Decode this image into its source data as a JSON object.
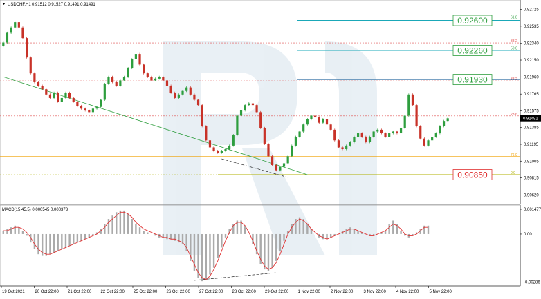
{
  "chart_data": [
    {
      "type": "line",
      "header_symbol": "USDCHF,H1",
      "header_values": "0.91512 0.91527 0.91491 0.91491",
      "y_ticks": [
        "0.92725",
        "0.92535",
        "0.92340",
        "0.92150",
        "0.91960",
        "0.91765",
        "0.91575",
        "0.91385",
        "0.91195",
        "0.91005",
        "0.90815",
        "0.90620"
      ],
      "y_ticks_num": [
        0.92725,
        0.92535,
        0.9234,
        0.9215,
        0.9196,
        0.91765,
        0.91575,
        0.91385,
        0.91195,
        0.91005,
        0.90815,
        0.9062
      ],
      "ylim": [
        0.90545,
        0.928
      ],
      "x_ticks": [
        "19 Oct 2021",
        "20 Oct 22:00",
        "21 Oct 22:00",
        "22 Oct 22:00",
        "25 Oct 22:00",
        "26 Oct 22:00",
        "27 Oct 22:00",
        "28 Oct 22:00",
        "29 Oct 22:00",
        "1 Nov 22:00",
        "2 Nov 22:00",
        "3 Nov 22:00",
        "4 Nov 22:00",
        "5 Nov 22:00"
      ],
      "current_price": "0.91491",
      "current_price_num": 0.91491,
      "fib_levels": [
        {
          "label": "61.8",
          "value": 0.92615,
          "color": "#2e9e3e"
        },
        {
          "label": "38.2",
          "value": 0.92345,
          "color": "#e05050"
        },
        {
          "label": "50.0",
          "value": 0.92265,
          "color": "#2e9e3e"
        },
        {
          "label": "38.2",
          "value": 0.91915,
          "color": "#e05050"
        },
        {
          "label": "23.6",
          "value": 0.91517,
          "color": "#e05050"
        },
        {
          "label": "76.0",
          "value": 0.91055,
          "color": "#f0a000"
        },
        {
          "label": "0.0",
          "value": 0.9085,
          "color": "#b0b000"
        }
      ],
      "targets": [
        {
          "text": "0.92600",
          "value": 0.926,
          "color": "#2e9e3e",
          "line": "#1aa8b8"
        },
        {
          "text": "0.92260",
          "value": 0.9226,
          "color": "#2e9e3e",
          "line": "#1aa8b8"
        },
        {
          "text": "0.91930",
          "value": 0.9193,
          "color": "#2e9e3e",
          "line": "#2a6aa0"
        },
        {
          "text": "0.90850",
          "value": 0.9085,
          "color": "#e03030",
          "line": "#b0b000"
        }
      ],
      "close_series": [
        0.9235,
        0.9246,
        0.9252,
        0.9258,
        0.9252,
        0.924,
        0.9218,
        0.92,
        0.919,
        0.9186,
        0.9182,
        0.9176,
        0.9172,
        0.9178,
        0.9168,
        0.9172,
        0.9178,
        0.9172,
        0.9168,
        0.9163,
        0.916,
        0.9158,
        0.9156,
        0.916,
        0.9162,
        0.917,
        0.9188,
        0.9196,
        0.919,
        0.9186,
        0.9192,
        0.9196,
        0.9206,
        0.9216,
        0.9222,
        0.921,
        0.92,
        0.9196,
        0.9192,
        0.9194,
        0.9196,
        0.9192,
        0.9186,
        0.9178,
        0.9172,
        0.9176,
        0.918,
        0.9184,
        0.9176,
        0.917,
        0.9164,
        0.914,
        0.9124,
        0.9116,
        0.9112,
        0.911,
        0.9112,
        0.9114,
        0.9118,
        0.913,
        0.9152,
        0.9158,
        0.9164,
        0.9166,
        0.9164,
        0.9156,
        0.9138,
        0.912,
        0.9106,
        0.9096,
        0.909,
        0.9094,
        0.9098,
        0.9106,
        0.9118,
        0.9128,
        0.9134,
        0.9142,
        0.9148,
        0.9152,
        0.915,
        0.9144,
        0.9148,
        0.9142,
        0.9136,
        0.9124,
        0.9116,
        0.9114,
        0.9118,
        0.9122,
        0.9128,
        0.9132,
        0.9128,
        0.9122,
        0.9128,
        0.9134,
        0.9136,
        0.9132,
        0.9128,
        0.9132,
        0.9134,
        0.9132,
        0.9138,
        0.9152,
        0.9176,
        0.9164,
        0.914,
        0.9126,
        0.9118,
        0.9124,
        0.9128,
        0.9132,
        0.914,
        0.9146,
        0.9149
      ],
      "macd": {
        "label": "MACD(15,45,5) 0.000545 0.000373",
        "y_ticks": [
          "0.001477",
          "0.00",
          "-0.00286"
        ],
        "y_ticks_num": [
          0.001477,
          0.0,
          -0.00286
        ],
        "ylim": [
          -0.003,
          0.0016
        ],
        "hist": [
          0.0002,
          0.0003,
          0.0004,
          0.0005,
          0.0004,
          0.0002,
          -0.0001,
          -0.0005,
          -0.0009,
          -0.0012,
          -0.0013,
          -0.0013,
          -0.0012,
          -0.0011,
          -0.001,
          -0.0009,
          -0.0008,
          -0.0007,
          -0.0006,
          -0.0005,
          -0.0004,
          -0.0003,
          -0.0002,
          -0.0001,
          0.0001,
          0.0003,
          0.0006,
          0.0009,
          0.0011,
          0.0013,
          0.0014,
          0.0014,
          0.0012,
          0.0009,
          0.0006,
          0.0004,
          0.0002,
          0.0001,
          -0.0,
          -0.0001,
          -0.0002,
          -0.0002,
          -0.0003,
          -0.0003,
          -0.0004,
          -0.0005,
          -0.0006,
          -0.001,
          -0.0016,
          -0.0022,
          -0.0026,
          -0.0028,
          -0.0027,
          -0.0024,
          -0.002,
          -0.0014,
          -0.0008,
          -0.0002,
          0.0003,
          0.0006,
          0.0008,
          0.0008,
          0.0005,
          0.0,
          -0.0006,
          -0.0012,
          -0.0018,
          -0.0021,
          -0.0022,
          -0.002,
          -0.0016,
          -0.001,
          -0.0004,
          0.0002,
          0.0006,
          0.0009,
          0.001,
          0.0009,
          0.0006,
          0.0003,
          0.0,
          -0.0002,
          -0.0003,
          -0.0003,
          -0.0002,
          -0.0001,
          0.0,
          0.0002,
          0.0003,
          0.0004,
          0.0003,
          0.0002,
          0.0001,
          0.0,
          -0.0001,
          -0.0001,
          0.0,
          0.0001,
          0.0002,
          0.0006,
          0.0008,
          0.0006,
          0.0002,
          -0.0001,
          -0.0002,
          -0.0001,
          0.0001,
          0.0003,
          0.0005,
          0.0005
        ],
        "signal": [
          0.0002,
          0.0002,
          0.0003,
          0.0004,
          0.0004,
          0.0003,
          0.0001,
          -0.0002,
          -0.0006,
          -0.0009,
          -0.0011,
          -0.0012,
          -0.0012,
          -0.0011,
          -0.001,
          -0.0009,
          -0.0008,
          -0.0007,
          -0.0006,
          -0.0005,
          -0.0004,
          -0.0003,
          -0.0002,
          -0.0001,
          0.0,
          0.0002,
          0.0004,
          0.0007,
          0.0009,
          0.0011,
          0.0013,
          0.0013,
          0.0012,
          0.001,
          0.0007,
          0.0005,
          0.0003,
          0.0002,
          0.0001,
          0.0,
          -0.0001,
          -0.0002,
          -0.0002,
          -0.0003,
          -0.0003,
          -0.0004,
          -0.0005,
          -0.0008,
          -0.0013,
          -0.0018,
          -0.0023,
          -0.0026,
          -0.0027,
          -0.0025,
          -0.0021,
          -0.0016,
          -0.001,
          -0.0004,
          0.0001,
          0.0005,
          0.0007,
          0.0007,
          0.0005,
          0.0001,
          -0.0004,
          -0.001,
          -0.0015,
          -0.0019,
          -0.0021,
          -0.002,
          -0.0017,
          -0.0012,
          -0.0006,
          0.0,
          0.0004,
          0.0007,
          0.0009,
          0.0008,
          0.0006,
          0.0003,
          0.0001,
          -0.0001,
          -0.0002,
          -0.0003,
          -0.0002,
          -0.0001,
          0.0,
          0.0001,
          0.0002,
          0.0003,
          0.0003,
          0.0002,
          0.0001,
          0.0,
          -0.0001,
          -0.0001,
          0.0,
          0.0001,
          0.0002,
          0.0004,
          0.0006,
          0.0005,
          0.0003,
          0.0,
          -0.0001,
          -0.0001,
          0.0,
          0.0002,
          0.0004,
          0.0004
        ]
      }
    }
  ],
  "colors": {
    "bull": "#2e9e3e",
    "bear": "#c83228",
    "trendline": "#2e9e3e",
    "hist": "#aaaaaa",
    "signal": "#e03030",
    "grid_orange": "#f0a000",
    "current_price_bg": "#000000"
  },
  "icons": {
    "header_arrow": "triangle-down-icon"
  }
}
